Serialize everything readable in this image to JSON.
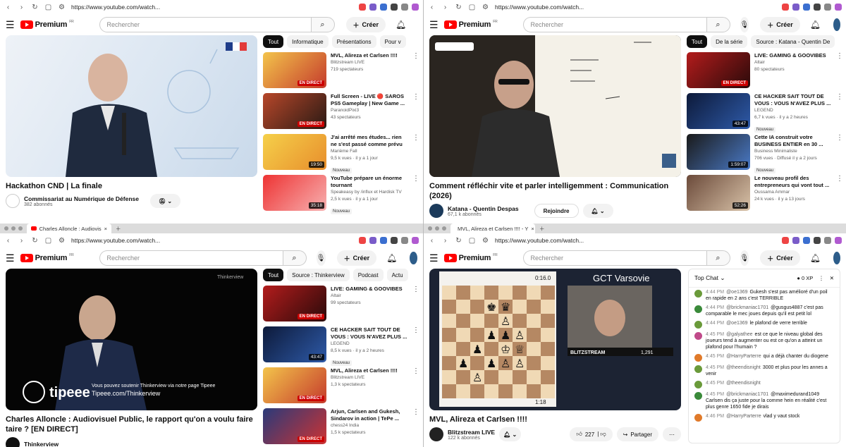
{
  "browser": {
    "url": "https://www.youtube.com/watch...",
    "search_placeholder": "Rechercher",
    "create_label": "Créer",
    "logo_text": "Premium",
    "logo_region": "FR"
  },
  "windows": [
    {
      "tab_title": "",
      "video": {
        "title": "Hackathon CND | La finale",
        "channel": "Commissariat au Numérique de Défense",
        "subs": "382 abonnés"
      },
      "chips": [
        "Tout",
        "Informatique",
        "Présentations",
        "Pour v"
      ],
      "recs": [
        {
          "title": "MVL, Alireza et Carlsen !!!!",
          "channel": "Blitzstream LIVE",
          "meta": "719 spectateurs",
          "badge": "EN DIRECT",
          "new": ""
        },
        {
          "title": "Full Screen - LIVE 🔴 SAROS PS5 Gameplay | New Game ...",
          "channel": "ParanoidPixi3",
          "meta": "43 spectateurs",
          "badge": "EN DIRECT",
          "new": ""
        },
        {
          "title": "J'ai arrêté mes études... rien ne s'est passé comme prévu",
          "channel": "Marième Fall",
          "meta": "9,5 k vues · il y a 1 jour",
          "badge": "19:50",
          "new": "Nouveau"
        },
        {
          "title": "YouTube prépare un énorme tournant",
          "channel": "Speakeasy by /influx et Hardisk TV",
          "meta": "2,5 k vues · il y a 1 jour",
          "badge": "35:18",
          "new": "Nouveau"
        }
      ]
    },
    {
      "tab_title": "",
      "video": {
        "title": "Comment réfléchir vite et parler intelligemment : Communication (2026)",
        "channel": "Katana - Quentin Despas",
        "subs": "67,1 k abonnés",
        "join": "Rejoindre"
      },
      "chips": [
        "Tout",
        "De la série",
        "Source : Katana - Quentin De"
      ],
      "recs": [
        {
          "title": "LIVE: GAMING & GOOVIBES",
          "channel": "Altair",
          "meta": "80 spectateurs",
          "badge": "EN DIRECT",
          "new": ""
        },
        {
          "title": "CE HACKER SAIT TOUT DE VOUS : VOUS N'AVEZ PLUS ...",
          "channel": "LEGEND",
          "meta": "6,7 k vues · il y a 2 heures",
          "badge": "43:47",
          "new": "Nouveau"
        },
        {
          "title": "Cette IA construit votre BUSINESS ENTIER en 30 ...",
          "channel": "Business Minimaliste",
          "meta": "706 vues · Diffusé il y a 2 jours",
          "badge": "1:59:07",
          "new": "Nouveau"
        },
        {
          "title": "Le nouveau profil des entrepreneurs qui vont tout ...",
          "channel": "Oussama Ammar",
          "meta": "24 k vues · il y a 13 jours",
          "badge": "52:26",
          "new": ""
        }
      ]
    },
    {
      "tab_title": "Charles Alloncle : Audiovis",
      "video": {
        "title": "Charles Alloncle : Audiovisuel Public, le rapport qu'on a voulu faire taire ? [EN DIRECT]",
        "channel": "Thinkerview",
        "subs": "",
        "overlay": "Vous pouvez soutenir Thinkerview via notre page Tipeee",
        "overlay2": "Tipeee.com/Thinkerview",
        "brand": "tipeee"
      },
      "chips": [
        "Tout",
        "Source : Thinkerview",
        "Podcast",
        "Actu"
      ],
      "recs": [
        {
          "title": "LIVE: GAMING & GOOVIBES",
          "channel": "Altair",
          "meta": "99 spectateurs",
          "badge": "EN DIRECT",
          "new": ""
        },
        {
          "title": "CE HACKER SAIT TOUT DE VOUS : VOUS N'AVEZ PLUS ...",
          "channel": "LEGEND",
          "meta": "8,5 k vues · il y a 2 heures",
          "badge": "43:47",
          "new": "Nouveau"
        },
        {
          "title": "MVL, Alireza et Carlsen !!!!",
          "channel": "Blitzstream LIVE",
          "meta": "1,3 k spectateurs",
          "badge": "EN DIRECT",
          "new": ""
        },
        {
          "title": "Arjun, Carlsen and Gukesh, Sindarov in action | TePe ...",
          "channel": "chess24 India",
          "meta": "1,5 k spectateurs",
          "badge": "EN DIRECT",
          "new": ""
        }
      ]
    },
    {
      "tab_title": "MVL, Alireza et Carlsen !!!! - Y",
      "video": {
        "title": "MVL, Alireza et Carlsen !!!!",
        "channel": "Blitzstream LIVE",
        "subs": "122 k abonnés",
        "likes": "227",
        "share": "Partager",
        "overlay": "GCT Varsovie",
        "brand": "BLITZSTREAM",
        "time1": "0:16.0",
        "time2": "1:18",
        "score": "1,291"
      },
      "chat": {
        "header": "Top Chat",
        "xp": "0 XP",
        "messages": [
          {
            "time": "4:44 PM",
            "user": "@oe1369",
            "text": "Gukesh s'est pas amélioré d'un poil en rapide en 2 ans c'est TERRIBLE",
            "color": "#6a9a3a"
          },
          {
            "time": "4:44 PM",
            "user": "@brickmaniac1701",
            "text": "@gusgus4887 c'est pas comparable le mec joues depuis qu'il est petit lol",
            "color": "#3a8a3a"
          },
          {
            "time": "4:44 PM",
            "user": "@oe1369",
            "text": "le plafond de verre terrible",
            "color": "#6a9a3a"
          },
          {
            "time": "4:45 PM",
            "user": "@galyathee",
            "text": "est ce que le niveau global des joueurs tend à augmenter ou est ce qu'on a atteint un plafond pour l'humain ?",
            "color": "#c04a8a"
          },
          {
            "time": "4:45 PM",
            "user": "@HarryParterre",
            "text": "qui a déjà chanter du diogene",
            "color": "#e07a2a"
          },
          {
            "time": "4:45 PM",
            "user": "@theendisnight",
            "text": "3000 et plus pour les annes a venir",
            "color": "#6a9a3a"
          },
          {
            "time": "4:45 PM",
            "user": "@theendisnight",
            "text": "",
            "color": "#6a9a3a"
          },
          {
            "time": "4:45 PM",
            "user": "@brickmaniac1701",
            "text": "@maximedurand1049 Carlsen dis ça juste pour la comme hein en réalité c'est plus genre 1650 fide je dirais",
            "color": "#3a8a3a"
          },
          {
            "time": "4:46 PM",
            "user": "@HarryParterre",
            "text": "vlad y vaut stock",
            "color": "#e07a2a"
          }
        ]
      }
    }
  ]
}
